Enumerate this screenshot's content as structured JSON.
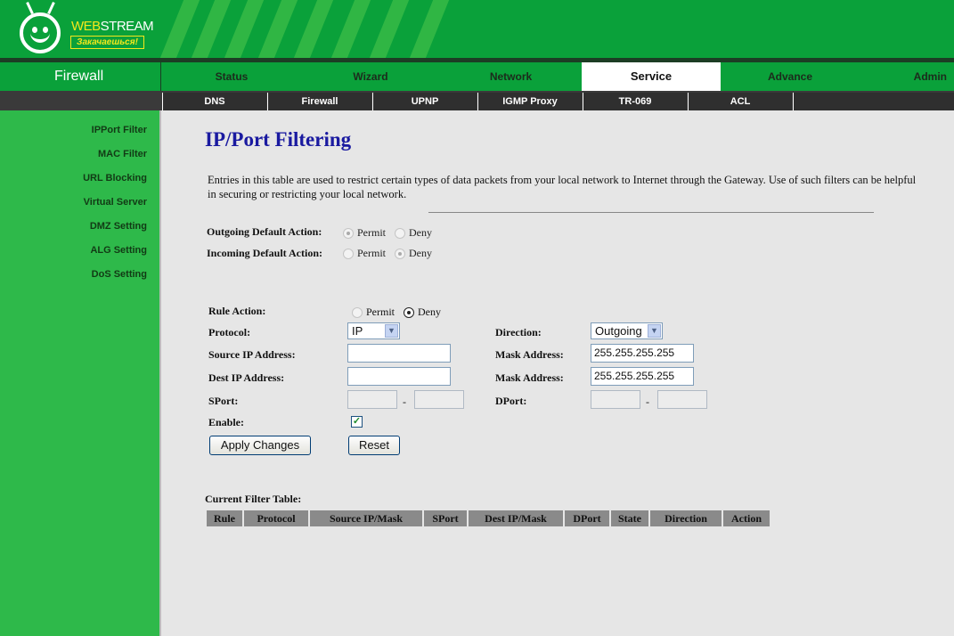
{
  "brand": {
    "name_web": "WEB",
    "name_stream": "STREAM",
    "tagline": "Закачаешься!"
  },
  "section_title": "Firewall",
  "main_nav": [
    {
      "label": "Status",
      "active": false
    },
    {
      "label": "Wizard",
      "active": false
    },
    {
      "label": "Network",
      "active": false
    },
    {
      "label": "Service",
      "active": true
    },
    {
      "label": "Advance",
      "active": false
    },
    {
      "label": "Admin",
      "active": false
    }
  ],
  "sub_nav": [
    "DNS",
    "Firewall",
    "UPNP",
    "IGMP Proxy",
    "TR-069",
    "ACL"
  ],
  "sidebar": [
    "IPPort Filter",
    "MAC Filter",
    "URL Blocking",
    "Virtual Server",
    "DMZ Setting",
    "ALG Setting",
    "DoS Setting"
  ],
  "page": {
    "title": "IP/Port Filtering",
    "description": "Entries in this table are used to restrict certain types of data packets from your local network to Internet through the Gateway. Use of such filters can be helpful in securing or restricting your local network.",
    "outgoing_label": "Outgoing Default Action:",
    "incoming_label": "Incoming Default Action:",
    "permit": "Permit",
    "deny": "Deny",
    "outgoing_default": "Permit",
    "incoming_default": "Deny"
  },
  "form": {
    "rule_action_label": "Rule Action:",
    "rule_action_value": "Deny",
    "protocol_label": "Protocol:",
    "protocol_value": "IP",
    "direction_label": "Direction:",
    "direction_value": "Outgoing",
    "source_ip_label": "Source IP Address:",
    "source_ip_value": "",
    "dest_ip_label": "Dest IP Address:",
    "dest_ip_value": "",
    "mask_label": "Mask Address:",
    "source_mask_value": "255.255.255.255",
    "dest_mask_value": "255.255.255.255",
    "sport_label": "SPort:",
    "dport_label": "DPort:",
    "dash": "-",
    "enable_label": "Enable:",
    "enable_checked": true,
    "apply_label": "Apply Changes",
    "reset_label": "Reset"
  },
  "table": {
    "title": "Current Filter Table:",
    "columns": [
      "Rule",
      "Protocol",
      "Source IP/Mask",
      "SPort",
      "Dest IP/Mask",
      "DPort",
      "State",
      "Direction",
      "Action"
    ]
  },
  "colors": {
    "header_green": "#0aa13a",
    "sidebar_green": "#2eb94a",
    "title_blue": "#1a1aa0"
  }
}
